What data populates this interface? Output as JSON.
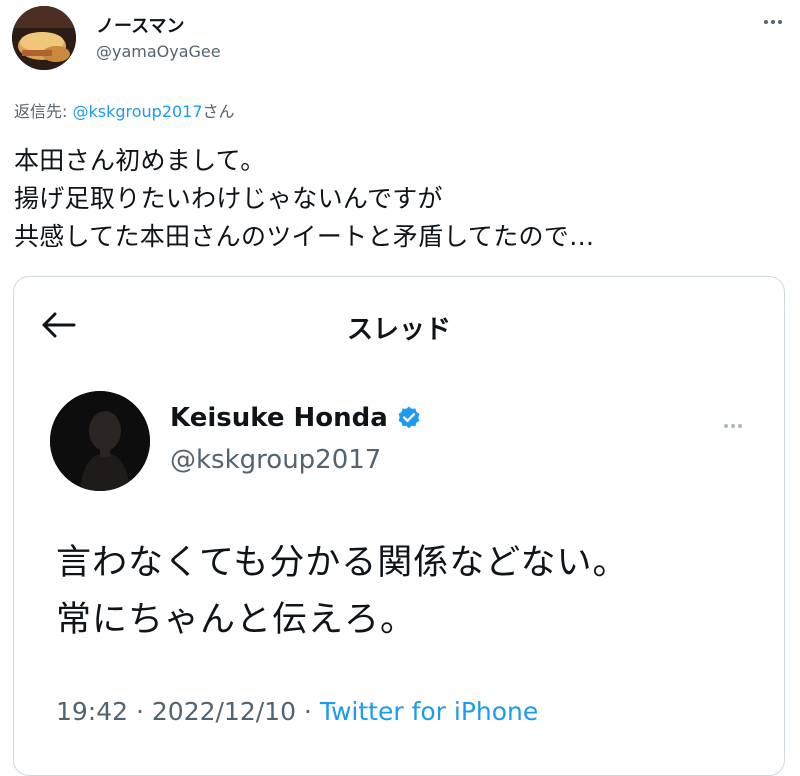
{
  "tweet": {
    "display_name": "ノースマン",
    "handle": "@yamaOyaGee",
    "reply_prefix": "返信先: ",
    "reply_mention": "@kskgroup2017",
    "reply_suffix": "さん",
    "body": "本田さん初めまして。\n揚げ足取りたいわけじゃないんですが\n共感してた本田さんのツイートと矛盾してたので…",
    "avatar_icon": "food-photo-avatar",
    "more_icon": "more-dots-icon"
  },
  "quoted": {
    "header_title": "スレッド",
    "back_icon": "back-arrow-icon",
    "display_name": "Keisuke Honda",
    "verified_icon": "verified-badge-icon",
    "handle": "@kskgroup2017",
    "text": "言わなくても分かる関係などない。\n常にちゃんと伝えろ。",
    "time": "19:42",
    "separator": " · ",
    "date": "2022/12/10",
    "source": "Twitter for iPhone",
    "accent_color": "#1d9bf0"
  }
}
